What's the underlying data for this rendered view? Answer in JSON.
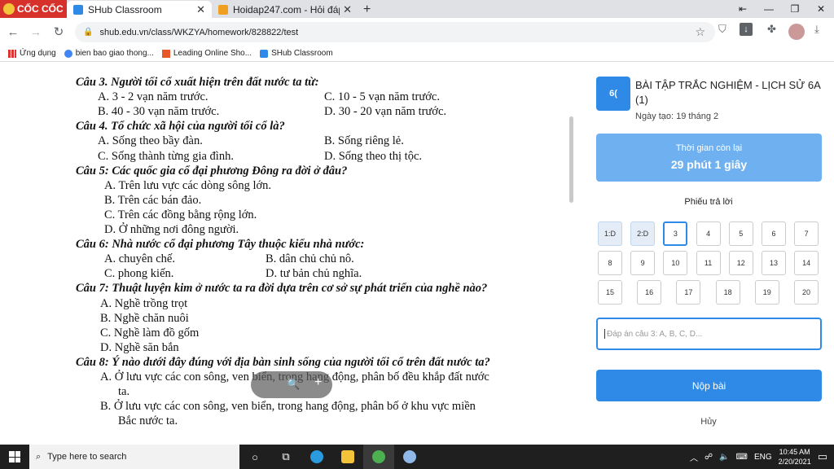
{
  "browser": {
    "brand": "CỐC CỐC",
    "tabs": [
      {
        "title": "SHub Classroom",
        "active": true
      },
      {
        "title": "Hoidap247.com - Hỏi đáp bà",
        "active": false
      }
    ],
    "url": "shub.edu.vn/class/WKZYA/homework/828822/test",
    "bookmarks": [
      "Ứng dụng",
      "bien bao giao thong...",
      "Leading Online Sho...",
      "SHub Classroom"
    ]
  },
  "document": {
    "lines": [
      {
        "kind": "q",
        "text": "Câu 3. Người tối cổ xuất hiện trên đất nước ta từ:"
      },
      {
        "kind": "a",
        "cols": [
          "A. 3 - 2 vạn năm trước.",
          "C. 10 - 5 vạn năm trước."
        ]
      },
      {
        "kind": "a",
        "cols": [
          "B. 40 - 30 vạn năm trước.",
          "D. 30 - 20 vạn năm trước."
        ]
      },
      {
        "kind": "q",
        "text": "Câu 4. Tổ chức xã hội của người tối cổ là?"
      },
      {
        "kind": "a",
        "cols": [
          "A. Sống theo bầy đàn.",
          "B. Sống riêng lẻ."
        ]
      },
      {
        "kind": "a",
        "cols": [
          "C. Sống thành từng gia đình.",
          "D. Sống theo thị tộc."
        ]
      },
      {
        "kind": "q",
        "text": "Câu 5: Các quốc gia cổ đại phương Đông ra đời ở đâu?"
      },
      {
        "kind": "a",
        "cols": [
          "A. Trên lưu vực các dòng sông lớn."
        ]
      },
      {
        "kind": "a",
        "cols": [
          "B. Trên các bán đảo."
        ]
      },
      {
        "kind": "a",
        "cols": [
          "C. Trên các đồng bằng rộng lớn."
        ]
      },
      {
        "kind": "a",
        "cols": [
          "D. Ở những nơi đông người."
        ]
      },
      {
        "kind": "q",
        "text": "Câu 6: Nhà nước cổ đại phương Tây thuộc kiểu nhà nước:"
      },
      {
        "kind": "a",
        "cols": [
          "A. chuyên chế.",
          "B. dân chủ chủ nô."
        ]
      },
      {
        "kind": "a",
        "cols": [
          "C. phong kiến.",
          "D. tư bản chủ nghĩa."
        ]
      },
      {
        "kind": "q",
        "text": "Câu 7: Thuật luyện kim ở nước ta ra đời dựa trên cơ sở sự phát triển của nghề nào?"
      },
      {
        "kind": "a",
        "cols": [
          "A. Nghề trồng trọt"
        ]
      },
      {
        "kind": "a",
        "cols": [
          "B. Nghề chăn nuôi"
        ]
      },
      {
        "kind": "a",
        "cols": [
          "C. Nghề làm đồ gốm"
        ]
      },
      {
        "kind": "a",
        "cols": [
          "D. Nghề săn bắn"
        ]
      },
      {
        "kind": "q",
        "text": "Câu 8: Ý nào dưới đây đúng với địa bàn sinh sống của người tối cổ trên đất nước ta?"
      },
      {
        "kind": "a",
        "cols": [
          "A. Ở lưu vực các con sông, ven biển, trong hang động, phân bố đều khắp đất nước"
        ]
      },
      {
        "kind": "a",
        "cols": [
          "ta."
        ]
      },
      {
        "kind": "a",
        "cols": [
          "B. Ở lưu vực các con sông, ven biển, trong hang động, phân bố ở khu vực miền"
        ]
      },
      {
        "kind": "a",
        "cols": [
          "Bắc nước ta."
        ]
      }
    ]
  },
  "homework": {
    "icon_text": "6(",
    "title": "BÀI TẬP TRẮC NGHIỆM - LỊCH SỬ 6A (1)",
    "created": "Ngày tạo: 19 tháng 2",
    "timer_label": "Thời gian còn lại",
    "timer_value": "29 phút 1 giây",
    "sheet_title": "Phiếu trả lời",
    "answers": [
      "1:D",
      "2:D",
      "3",
      "4",
      "5",
      "6",
      "7",
      "8",
      "9",
      "10",
      "11",
      "12",
      "13",
      "14",
      "15",
      "16",
      "17",
      "18",
      "19",
      "20"
    ],
    "answered": [
      0,
      1
    ],
    "current": 2,
    "answer_placeholder": "Đáp án câu 3: A, B, C, D...",
    "submit_label": "Nộp bài",
    "cancel_label": "Hủy"
  },
  "taskbar": {
    "search_placeholder": "Type here to search",
    "lang": "ENG",
    "time": "10:45 AM",
    "date": "2/20/2021"
  }
}
